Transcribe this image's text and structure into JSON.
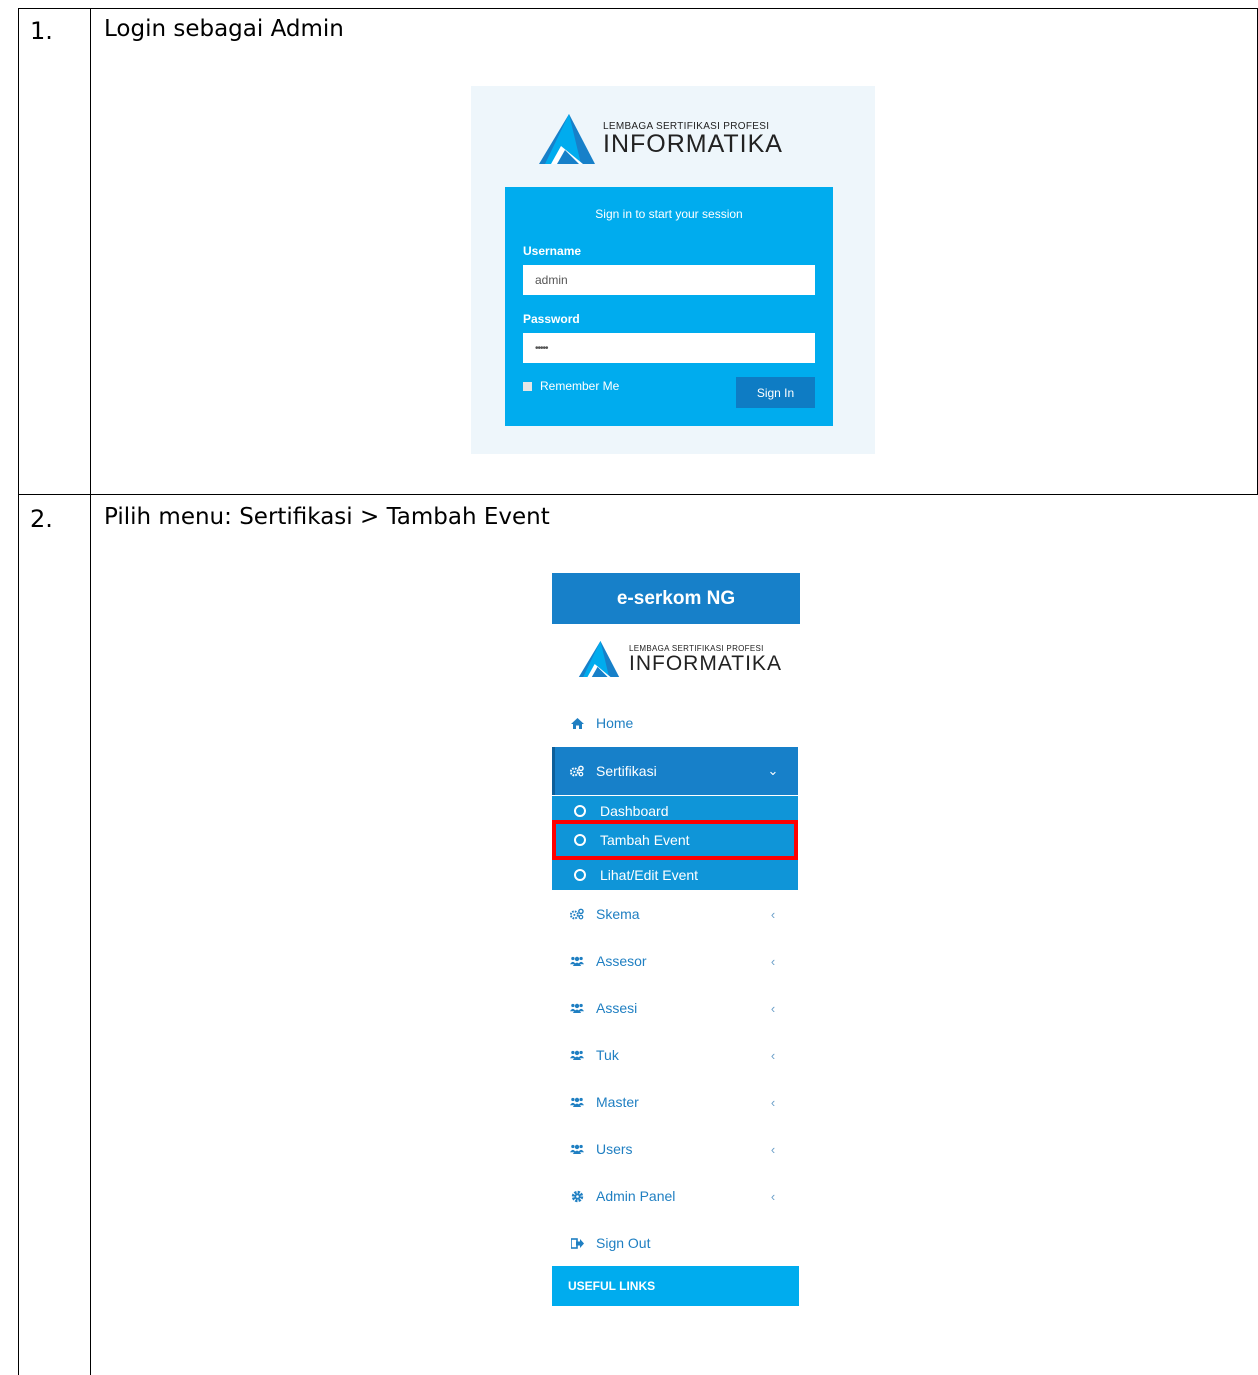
{
  "rows": [
    {
      "number": "1.",
      "title": "Login sebagai Admin"
    },
    {
      "number": "2.",
      "title": "Pilih menu: Sertifikasi > Tambah Event"
    }
  ],
  "logo": {
    "org_line": "LEMBAGA SERTIFIKASI PROFESI",
    "name": "INFORMATIKA"
  },
  "login": {
    "message": "Sign in to start your session",
    "username_label": "Username",
    "username_value": "admin",
    "password_label": "Password",
    "password_value": "•••••",
    "remember_label": "Remember Me",
    "signin_label": "Sign In"
  },
  "sidebar": {
    "app_title": "e-serkom NG",
    "items": [
      {
        "label": "Home",
        "icon": "home-icon"
      },
      {
        "label": "Sertifikasi",
        "icon": "gears-icon",
        "expanded": true
      },
      {
        "label": "Skema",
        "icon": "gears-icon"
      },
      {
        "label": "Assesor",
        "icon": "users-icon"
      },
      {
        "label": "Assesi",
        "icon": "users-icon"
      },
      {
        "label": "Tuk",
        "icon": "users-icon"
      },
      {
        "label": "Master",
        "icon": "users-icon"
      },
      {
        "label": "Users",
        "icon": "users-icon"
      },
      {
        "label": "Admin Panel",
        "icon": "gear-icon"
      },
      {
        "label": "Sign Out",
        "icon": "sign-out-icon"
      }
    ],
    "submenu": [
      {
        "label": "Dashboard"
      },
      {
        "label": "Tambah Event",
        "highlighted": true
      },
      {
        "label": "Lihat/Edit Event"
      }
    ],
    "footer_label": "USEFUL LINKS"
  },
  "colors": {
    "primary": "#1780c9",
    "accent": "#00acee",
    "highlight_border": "#ff0000"
  }
}
